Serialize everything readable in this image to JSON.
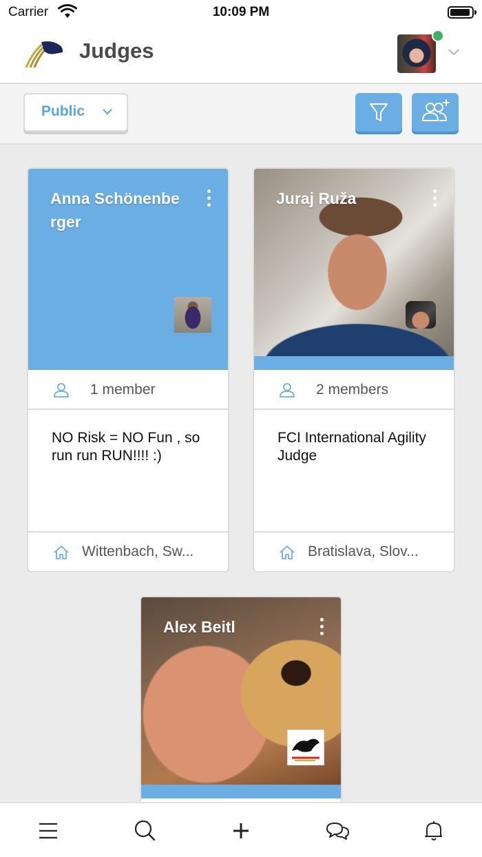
{
  "status_bar": {
    "carrier": "Carrier",
    "time": "10:09 PM"
  },
  "header": {
    "title": "Judges"
  },
  "filter_bar": {
    "visibility_selected": "Public"
  },
  "judges": [
    {
      "name": "Anna Schönenberger",
      "members": "1 member",
      "description": "NO Risk = NO Fun , so run run RUN!!!! :)",
      "location": "Wittenbach, Sw..."
    },
    {
      "name": "Juraj Ruža",
      "members": "2 members",
      "description": "FCI International Agility Judge",
      "location": "Bratislava, Slov..."
    },
    {
      "name": "Alex Beitl"
    }
  ],
  "colors": {
    "accent": "#6aaee4",
    "online": "#3fb261",
    "title": "#4a4a4a",
    "background": "#ebebeb"
  },
  "bottom_nav": [
    "menu-icon",
    "search-icon",
    "plus-icon",
    "chat-icon",
    "bell-icon"
  ]
}
